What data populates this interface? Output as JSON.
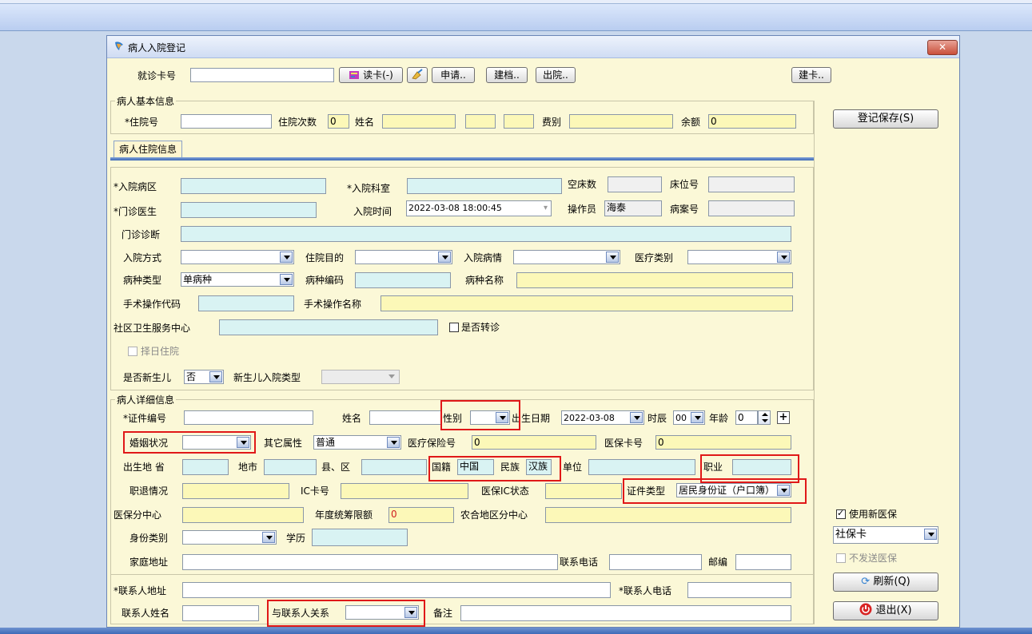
{
  "window": {
    "title": "病人入院登记",
    "close_label": "✕"
  },
  "cardbar": {
    "card_no_label": "就诊卡号",
    "card_no_value": "",
    "read_card_label": "读卡(-)",
    "apply_label": "申请..",
    "create_record_label": "建档..",
    "discharge_label": "出院..",
    "create_card_label": "建卡.."
  },
  "basic": {
    "group_title": "病人基本信息",
    "inpatient_no_label": "*住院号",
    "inpatient_no_value": "",
    "times_label": "住院次数",
    "times_value": "0",
    "name_label": "姓名",
    "fee_type_label": "费别",
    "balance_label": "余额",
    "balance_value": "0"
  },
  "tab": {
    "label": "病人住院信息"
  },
  "admission": {
    "ward_label": "*入院病区",
    "dept_label": "*入院科室",
    "empty_beds_label": "空床数",
    "bed_no_label": "床位号",
    "doctor_label": "*门诊医生",
    "time_label": "入院时间",
    "time_value": "2022-03-08 18:00:45",
    "operator_label": "操作员",
    "operator_value": "海泰",
    "case_no_label": "病案号",
    "diagnosis_label": "门诊诊断",
    "mode_label": "入院方式",
    "purpose_label": "住院目的",
    "condition_label": "入院病情",
    "medical_type_label": "医疗类别",
    "disease_type_label": "病种类型",
    "disease_type_value": "单病种",
    "disease_code_label": "病种编码",
    "disease_name_label": "病种名称",
    "surgery_code_label": "手术操作代码",
    "surgery_name_label": "手术操作名称",
    "community_label": "社区卫生服务中心",
    "referral_label": "是否转诊",
    "select_date_label": "择日住院",
    "newborn_label": "是否新生儿",
    "newborn_value": "否",
    "newborn_type_label": "新生儿入院类型"
  },
  "detail": {
    "group_title": "病人详细信息",
    "id_no_label": "*证件编号",
    "name_label": "姓名",
    "gender_label": "性别",
    "birth_label": "出生日期",
    "birth_value": "2022-03-08",
    "hour_label": "时辰",
    "hour_value": "00",
    "age_label": "年龄",
    "age_value": "0",
    "plus_label": "+",
    "marital_label": "婚姻状况",
    "other_attr_label": "其它属性",
    "other_attr_value": "普通",
    "insurance_no_label": "医疗保险号",
    "insurance_no_value": "0",
    "insurance_card_label": "医保卡号",
    "insurance_card_value": "0",
    "birthplace_label": "出生地 省",
    "city_label": "地市",
    "county_label": "县、区",
    "nationality_label": "国籍",
    "nationality_value": "中国",
    "ethnic_label": "民族",
    "ethnic_value": "汉族",
    "employer_label": "单位",
    "occupation_label": "职业",
    "retire_label": "职退情况",
    "ic_card_label": "IC卡号",
    "insurance_status_label": "医保IC状态",
    "id_type_label": "证件类型",
    "id_type_value": "居民身份证（户口簿）",
    "insurance_center_label": "医保分中心",
    "annual_limit_label": "年度统筹限额",
    "annual_limit_value": "0",
    "rural_center_label": "农合地区分中心",
    "identity_label": "身份类别",
    "education_label": "学历",
    "address_label": "家庭地址",
    "phone_label": "联系电话",
    "zip_label": "邮编",
    "contact_address_label": "*联系人地址",
    "contact_phone_label": "*联系人电话",
    "contact_name_label": "联系人姓名",
    "relation_label": "与联系人关系",
    "remark_label": "备注"
  },
  "right_panel": {
    "save_label": "登记保存(S)",
    "use_new_insurance_label": "使用新医保",
    "card_type_value": "社保卡",
    "no_send_label": "不发送医保",
    "refresh_label": "刷新(Q)",
    "exit_label": "退出(X)"
  },
  "colors": {
    "window_bg": "#fbf8d7",
    "highlight_red": "#e01818",
    "input_cyan": "#d9f3f3",
    "input_yellow": "#fcf8b8"
  }
}
